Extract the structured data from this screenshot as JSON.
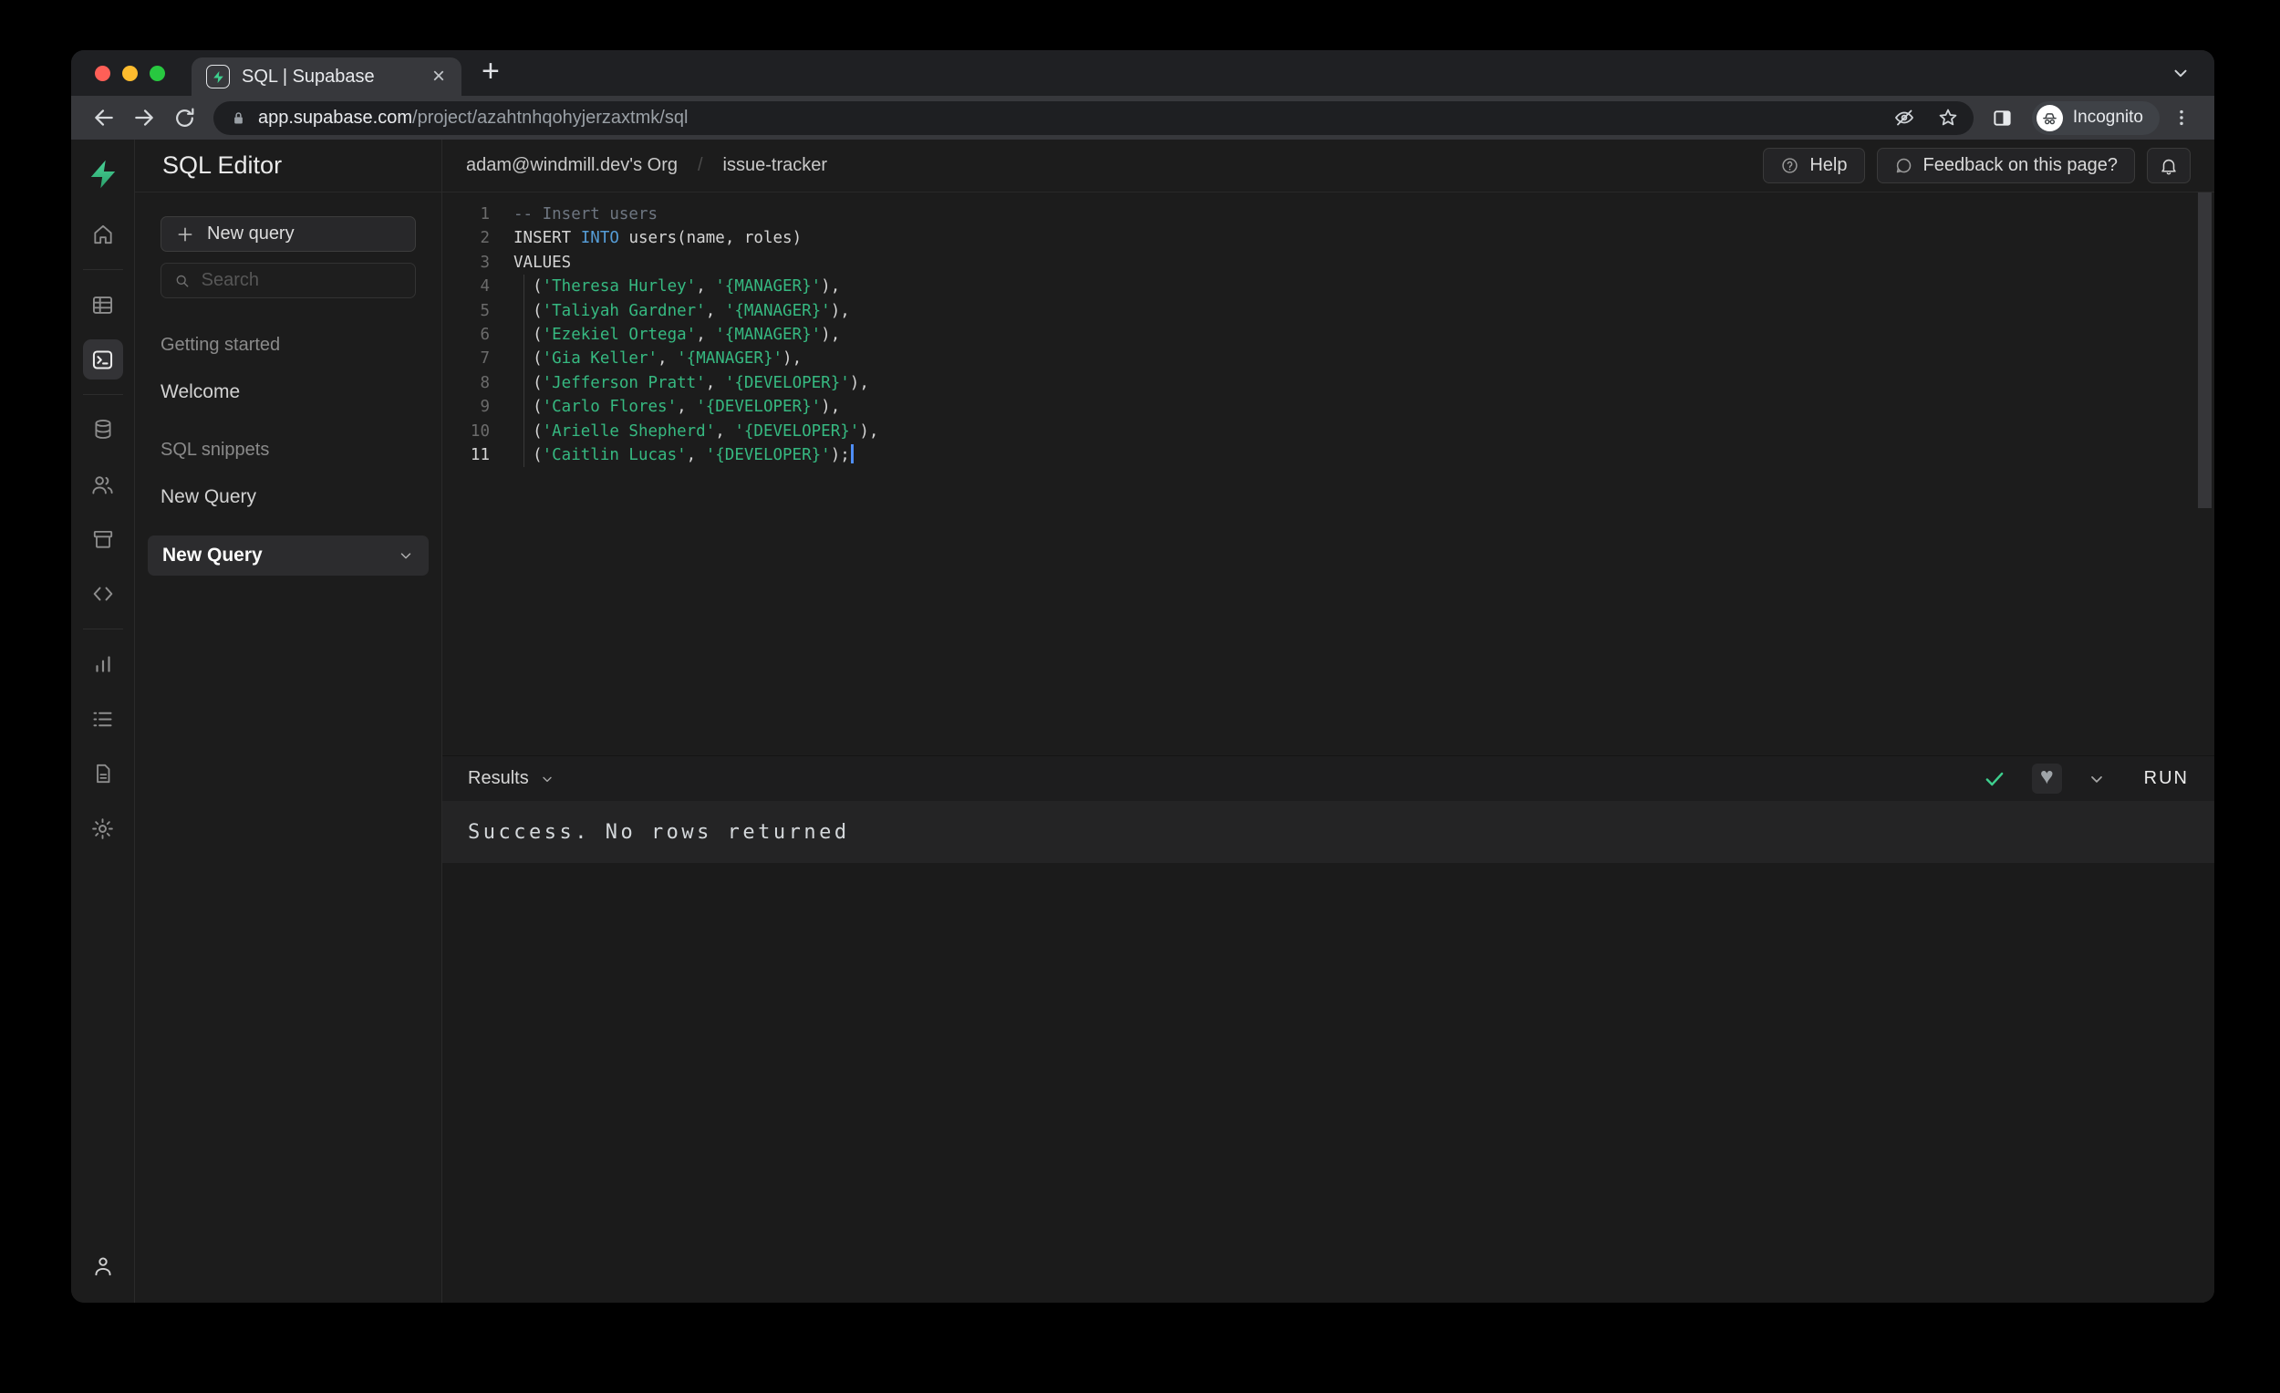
{
  "browser": {
    "tab": {
      "title": "SQL | Supabase",
      "close_glyph": "×"
    },
    "new_tab_glyph": "+",
    "url": {
      "host": "app.supabase.com",
      "path": "/project/azahtnhqohyjerzaxtmk/sql"
    },
    "incognito_label": "Incognito",
    "traffic_lights": [
      "close",
      "minimize",
      "zoom"
    ]
  },
  "rail_icons": [
    "supabase-logo",
    "home",
    "table-editor",
    "sql-editor",
    "database",
    "auth-users",
    "storage",
    "api-code",
    "reports",
    "logs",
    "docs",
    "settings",
    "account"
  ],
  "sidebar": {
    "title": "SQL Editor",
    "new_query_label": "New query",
    "search_placeholder": "Search",
    "sections": [
      {
        "label": "Getting started",
        "items": [
          {
            "label": "Welcome",
            "active": false
          }
        ]
      },
      {
        "label": "SQL snippets",
        "items": [
          {
            "label": "New Query",
            "active": false
          },
          {
            "label": "New Query",
            "active": true
          }
        ]
      }
    ]
  },
  "header": {
    "org": "adam@windmill.dev's Org",
    "separator": "/",
    "project": "issue-tracker",
    "help_label": "Help",
    "feedback_label": "Feedback on this page?"
  },
  "editor": {
    "colors": {
      "plain": "#d4d4d4",
      "comment": "#6e7681",
      "keyword": "#559cd6",
      "string": "#36b981",
      "line_number": "#6b6b6b",
      "line_number_active": "#d6d6d6",
      "caret": "#4f8ef7"
    },
    "lines": [
      {
        "num": "1",
        "tokens": [
          {
            "type": "comment",
            "text": "-- Insert users"
          }
        ]
      },
      {
        "num": "2",
        "tokens": [
          {
            "type": "plain",
            "text": "INSERT "
          },
          {
            "type": "keyword",
            "text": "INTO"
          },
          {
            "type": "plain",
            "text": " users(name, roles)"
          }
        ]
      },
      {
        "num": "3",
        "tokens": [
          {
            "type": "plain",
            "text": "VALUES"
          }
        ]
      },
      {
        "num": "4",
        "indent": true,
        "tokens": [
          {
            "type": "plain",
            "text": "  ("
          },
          {
            "type": "string",
            "text": "'Theresa Hurley'"
          },
          {
            "type": "plain",
            "text": ", "
          },
          {
            "type": "string",
            "text": "'{MANAGER}'"
          },
          {
            "type": "plain",
            "text": "),"
          }
        ]
      },
      {
        "num": "5",
        "indent": true,
        "tokens": [
          {
            "type": "plain",
            "text": "  ("
          },
          {
            "type": "string",
            "text": "'Taliyah Gardner'"
          },
          {
            "type": "plain",
            "text": ", "
          },
          {
            "type": "string",
            "text": "'{MANAGER}'"
          },
          {
            "type": "plain",
            "text": "),"
          }
        ]
      },
      {
        "num": "6",
        "indent": true,
        "tokens": [
          {
            "type": "plain",
            "text": "  ("
          },
          {
            "type": "string",
            "text": "'Ezekiel Ortega'"
          },
          {
            "type": "plain",
            "text": ", "
          },
          {
            "type": "string",
            "text": "'{MANAGER}'"
          },
          {
            "type": "plain",
            "text": "),"
          }
        ]
      },
      {
        "num": "7",
        "indent": true,
        "tokens": [
          {
            "type": "plain",
            "text": "  ("
          },
          {
            "type": "string",
            "text": "'Gia Keller'"
          },
          {
            "type": "plain",
            "text": ", "
          },
          {
            "type": "string",
            "text": "'{MANAGER}'"
          },
          {
            "type": "plain",
            "text": "),"
          }
        ]
      },
      {
        "num": "8",
        "indent": true,
        "tokens": [
          {
            "type": "plain",
            "text": "  ("
          },
          {
            "type": "string",
            "text": "'Jefferson Pratt'"
          },
          {
            "type": "plain",
            "text": ", "
          },
          {
            "type": "string",
            "text": "'{DEVELOPER}'"
          },
          {
            "type": "plain",
            "text": "),"
          }
        ]
      },
      {
        "num": "9",
        "indent": true,
        "tokens": [
          {
            "type": "plain",
            "text": "  ("
          },
          {
            "type": "string",
            "text": "'Carlo Flores'"
          },
          {
            "type": "plain",
            "text": ", "
          },
          {
            "type": "string",
            "text": "'{DEVELOPER}'"
          },
          {
            "type": "plain",
            "text": "),"
          }
        ]
      },
      {
        "num": "10",
        "indent": true,
        "tokens": [
          {
            "type": "plain",
            "text": "  ("
          },
          {
            "type": "string",
            "text": "'Arielle Shepherd'"
          },
          {
            "type": "plain",
            "text": ", "
          },
          {
            "type": "string",
            "text": "'{DEVELOPER}'"
          },
          {
            "type": "plain",
            "text": "),"
          }
        ]
      },
      {
        "num": "11",
        "indent": true,
        "active": true,
        "caret": true,
        "tokens": [
          {
            "type": "plain",
            "text": "  ("
          },
          {
            "type": "string",
            "text": "'Caitlin Lucas'"
          },
          {
            "type": "plain",
            "text": ", "
          },
          {
            "type": "string",
            "text": "'{DEVELOPER}'"
          },
          {
            "type": "plain",
            "text": ");"
          }
        ]
      }
    ]
  },
  "results": {
    "label": "Results",
    "run_label": "RUN",
    "message": "Success. No rows returned"
  },
  "colors": {
    "brand_green": "#3ecf8e",
    "success_check": "#3ecf8e",
    "app_background": "#1c1c1c"
  }
}
